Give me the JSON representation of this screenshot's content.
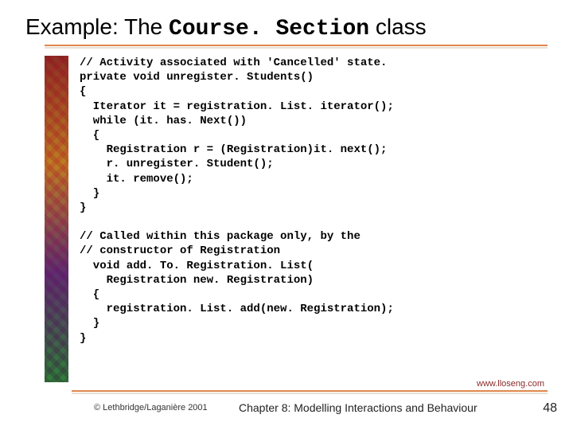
{
  "title": {
    "prefix": "Example: The ",
    "mono": "Course. Section",
    "suffix": " class"
  },
  "code": "// Activity associated with 'Cancelled' state.\nprivate void unregister. Students()\n{\n  Iterator it = registration. List. iterator();\n  while (it. has. Next())\n  {\n    Registration r = (Registration)it. next();\n    r. unregister. Student();\n    it. remove();\n  }\n}\n\n// Called within this package only, by the\n// constructor of Registration\n  void add. To. Registration. List(\n    Registration new. Registration)\n  {\n    registration. List. add(new. Registration);\n  }\n}",
  "url": "www.lloseng.com",
  "footer": {
    "copyright": "© Lethbridge/Laganière 2001",
    "chapter": "Chapter 8: Modelling Interactions and Behaviour",
    "page": "48"
  }
}
